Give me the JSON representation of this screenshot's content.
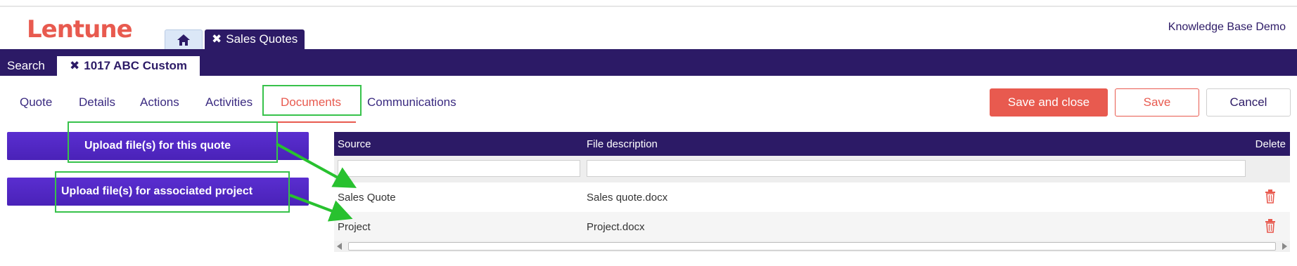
{
  "app": {
    "logo": "Lentune",
    "account": "Knowledge Base Demo"
  },
  "top_tabs": {
    "home_icon": "home-icon",
    "active_tab": "Sales Quotes",
    "close_icon": "close-icon"
  },
  "nav": {
    "search_label": "Search",
    "record_tab": "1017 ABC Custom"
  },
  "subtabs": [
    "Quote",
    "Details",
    "Actions",
    "Activities",
    "Documents",
    "Communications"
  ],
  "active_subtab": "Documents",
  "actions": {
    "save_close": "Save and close",
    "save": "Save",
    "cancel": "Cancel"
  },
  "uploads": {
    "quote": "Upload file(s) for this quote",
    "project": "Upload file(s) for associated project"
  },
  "grid": {
    "columns": [
      "Source",
      "File description",
      "Delete"
    ],
    "rows": [
      {
        "source": "Sales Quote",
        "description": "Sales quote.docx",
        "delete_icon": "trash-icon"
      },
      {
        "source": "Project",
        "description": "Project.docx",
        "delete_icon": "trash-icon"
      }
    ]
  },
  "colors": {
    "brand": "#e85a4f",
    "nav": "#2c1a66",
    "upload_button": "#4a22b8",
    "highlight": "#37c24b"
  }
}
